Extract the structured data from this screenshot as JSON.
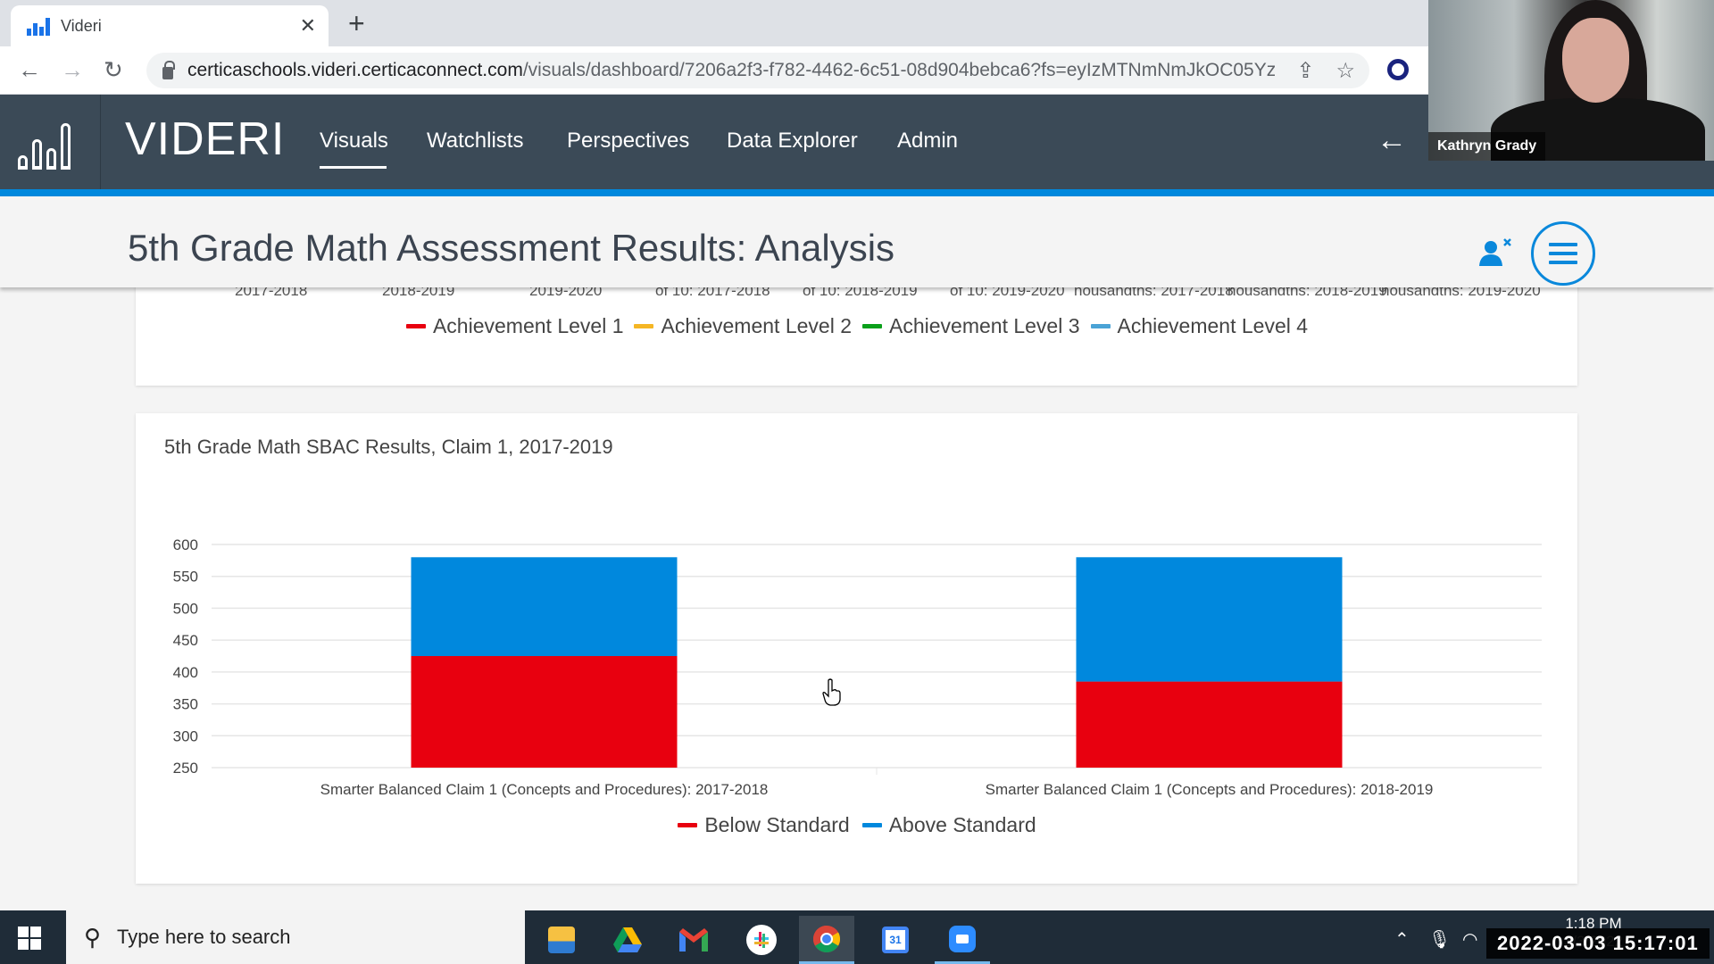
{
  "browser": {
    "tab_title": "Videri",
    "url_host": "certicaschools.videri.certicaconnect.com",
    "url_path": "/visuals/dashboard/7206a2f3-f782-4462-6c51-08d904bebca6?fs=eyIzMTNmNmJkOC05Yz..."
  },
  "app": {
    "brand": "VIDERI",
    "nav": [
      "Visuals",
      "Watchlists",
      "Perspectives",
      "Data Explorer",
      "Admin"
    ],
    "active_nav": "Visuals",
    "page_title": "5th Grade Math Assessment Results: Analysis"
  },
  "video": {
    "participant_name": "Kathryn Grady"
  },
  "chart1_partial": {
    "x_tick_labels_cut": [
      "2017-2018",
      "2018-2019",
      "2019-2020",
      "of 10: 2017-2018",
      "of 10: 2018-2019",
      "of 10: 2019-2020",
      "housandths: 2017-2018",
      "housandths: 2018-2019",
      "housandths: 2019-2020"
    ],
    "legend": [
      {
        "label": "Achievement Level 1",
        "color": "#e8000f"
      },
      {
        "label": "Achievement Level 2",
        "color": "#f5b624"
      },
      {
        "label": "Achievement Level 3",
        "color": "#0aa01a"
      },
      {
        "label": "Achievement Level 4",
        "color": "#4aa3d6"
      }
    ]
  },
  "chart_data": {
    "type": "bar",
    "stacked": true,
    "title": "5th Grade Math SBAC Results, Claim 1, 2017-2019",
    "categories": [
      "Smarter Balanced Claim 1 (Concepts and Procedures): 2017-2018",
      "Smarter Balanced Claim 1 (Concepts and Procedures): 2018-2019"
    ],
    "series": [
      {
        "name": "Below Standard",
        "color": "#e8000f",
        "range_from": [
          250,
          250
        ],
        "range_to": [
          425,
          385
        ]
      },
      {
        "name": "Above Standard",
        "color": "#0088dd",
        "range_from": [
          425,
          385
        ],
        "range_to": [
          580,
          580
        ]
      }
    ],
    "xlabel": "",
    "ylabel": "",
    "ylim": [
      250,
      600
    ],
    "yticks": [
      250,
      300,
      350,
      400,
      450,
      500,
      550,
      600
    ],
    "grid": true,
    "legend_position": "bottom"
  },
  "taskbar": {
    "search_placeholder": "Type here to search",
    "apps": [
      "file-explorer",
      "google-drive",
      "gmail",
      "slack",
      "chrome",
      "google-calendar",
      "zoom"
    ],
    "active_app": "chrome",
    "clock_time": "1:18 PM",
    "clock_date": "3/3/2022",
    "recording_stamp": "2022-03-03 15:17:01"
  }
}
